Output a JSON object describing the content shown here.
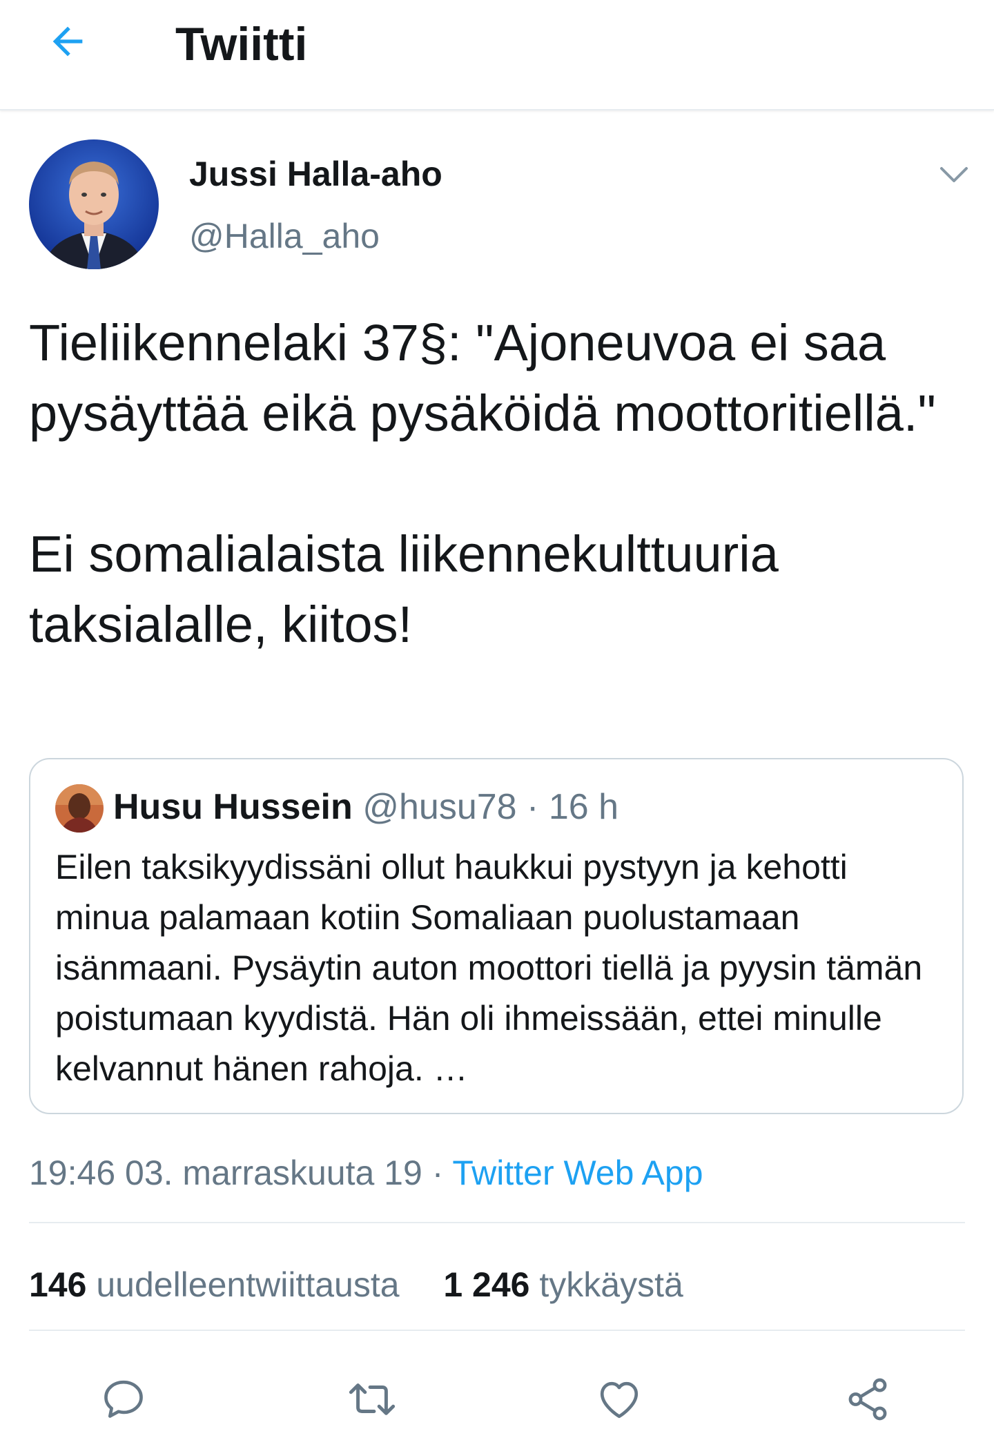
{
  "colors": {
    "accent": "#1da1f2",
    "text_primary": "#14171a",
    "text_secondary": "#657786",
    "border": "#ccd6dd",
    "divider": "#e6ecf0"
  },
  "topbar": {
    "back_icon": "arrow-left-icon",
    "title": "Twiitti"
  },
  "tweet": {
    "author": {
      "name": "Jussi Halla-aho",
      "handle": "@Halla_aho"
    },
    "menu_icon": "chevron-down-icon",
    "text_paragraph_1": "Tieliikennelaki 37§: \"Ajoneuvoa ei saa pysäyttää eikä pysäköidä moottoritiellä.\"",
    "text_paragraph_2": "Ei somalialaista liikennekulttuuria taksialalle, kiitos!",
    "quoted": {
      "name": "Husu Hussein",
      "handle": "@husu78",
      "separator": "·",
      "time": "16 h",
      "text": "Eilen taksikyydissäni ollut haukkui pystyyn ja kehotti minua palamaan kotiin Somaliaan puolustamaan isänmaani. Pysäytin auton moottori tiellä ja pyysin tämän poistumaan kyydistä. Hän oli ihmeissään, ettei minulle kelvannut hänen rahoja. …"
    },
    "timestamp": "19:46 03. marraskuuta 19",
    "source_separator": "·",
    "source": "Twitter Web App",
    "retweets_count": "146",
    "retweets_label": "uudelleentwiittausta",
    "likes_count": "1 246",
    "likes_label": "tykkäystä"
  },
  "actions": [
    {
      "icon": "reply-icon"
    },
    {
      "icon": "retweet-icon"
    },
    {
      "icon": "like-icon"
    },
    {
      "icon": "share-icon"
    }
  ]
}
